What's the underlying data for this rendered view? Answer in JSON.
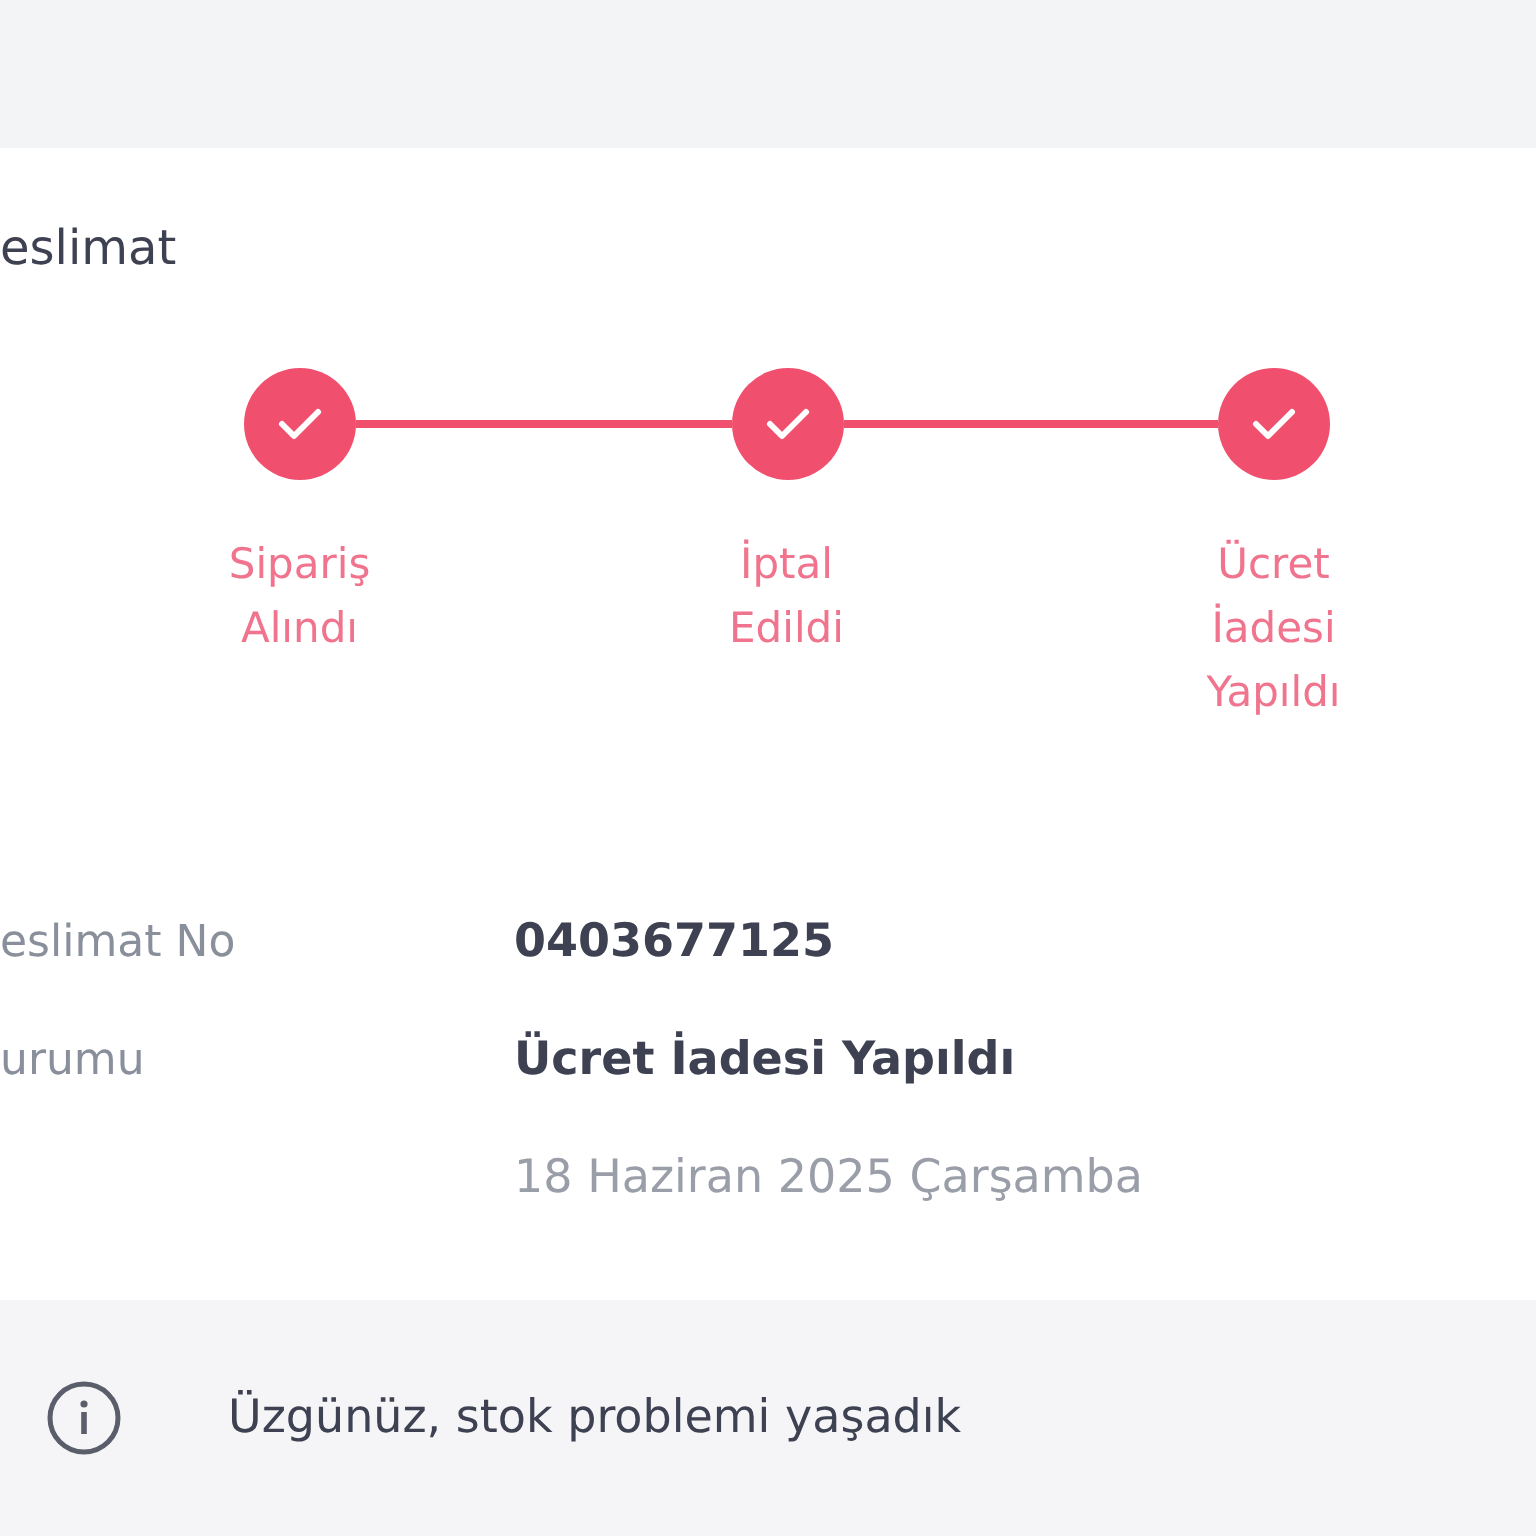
{
  "section_title": "eslimat",
  "steps": [
    {
      "label": "Sipariş Alındı",
      "done": true
    },
    {
      "label": "İptal Edildi",
      "done": true
    },
    {
      "label": "Ücret İadesi Yapıldı",
      "done": true
    }
  ],
  "details": [
    {
      "label": "eslimat No",
      "value": "0403677125",
      "kind": "main"
    },
    {
      "label": "urumu",
      "value": "Ücret İadesi Yapıldı",
      "kind": "main"
    },
    {
      "value": "18 Haziran 2025 Çarşamba",
      "kind": "muted"
    }
  ],
  "notice": {
    "text": "Üzgünüz, stok problemi yaşadık"
  }
}
